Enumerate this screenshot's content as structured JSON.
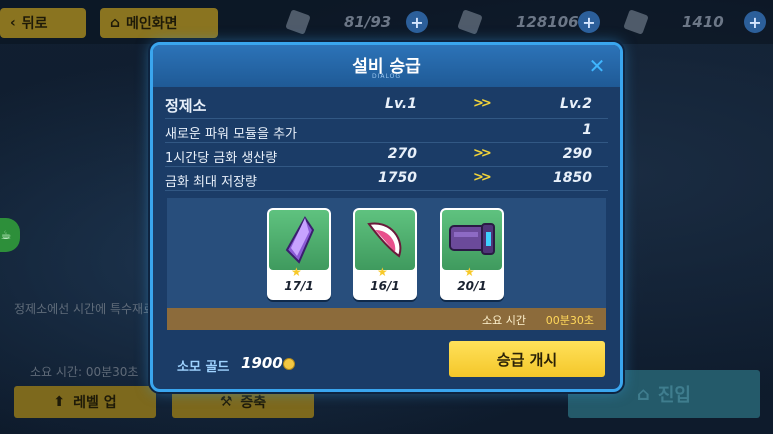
{
  "topbar": {
    "back_label": "뒤로",
    "home_label": "메인화면",
    "resources": [
      {
        "icon": "energy-cell-icon",
        "value": "81/93"
      },
      {
        "icon": "gold-bar-icon",
        "value": "128106"
      },
      {
        "icon": "crystal-icon",
        "value": "1410"
      }
    ],
    "plus_glyph": "+"
  },
  "background": {
    "description": "정제소에선 시간에 특수재료가 생산됩",
    "time_text": "소요 시간: 00분30초",
    "level_up_label": "레벨 업",
    "expand_label": "증축",
    "enter_label": "진입"
  },
  "dialog": {
    "title": "설비 승급",
    "subtitle": "DIALOG",
    "close_glyph": "✕",
    "header": {
      "name": "정제소",
      "cur": "Lv.1",
      "next": "Lv.2"
    },
    "rows": [
      {
        "label": "새로운 파워 모듈을 추가",
        "cur": "",
        "next": "1"
      },
      {
        "label": "1시간당 금화 생산량",
        "cur": "270",
        "next": "290"
      },
      {
        "label": "금화 최대 저장량",
        "cur": "1750",
        "next": "1850"
      }
    ],
    "arrow_glyph": ">>",
    "materials": [
      {
        "icon": "purple-crystal-icon",
        "qty": "17/1"
      },
      {
        "icon": "pink-horn-icon",
        "qty": "16/1"
      },
      {
        "icon": "mech-gauntlet-icon",
        "qty": "20/1"
      }
    ],
    "time_label": "소요 시간",
    "time_value": "00분30초",
    "gold_label": "소모 골드",
    "gold_value": "1900",
    "upgrade_label": "승급 개시"
  },
  "colors": {
    "accent": "#3aa6ef",
    "button_yellow": "#f4c72a",
    "arrow_yellow": "#f1d33a",
    "material_bg": "#3f9a5e",
    "time_bar": "#8c6b3b"
  }
}
